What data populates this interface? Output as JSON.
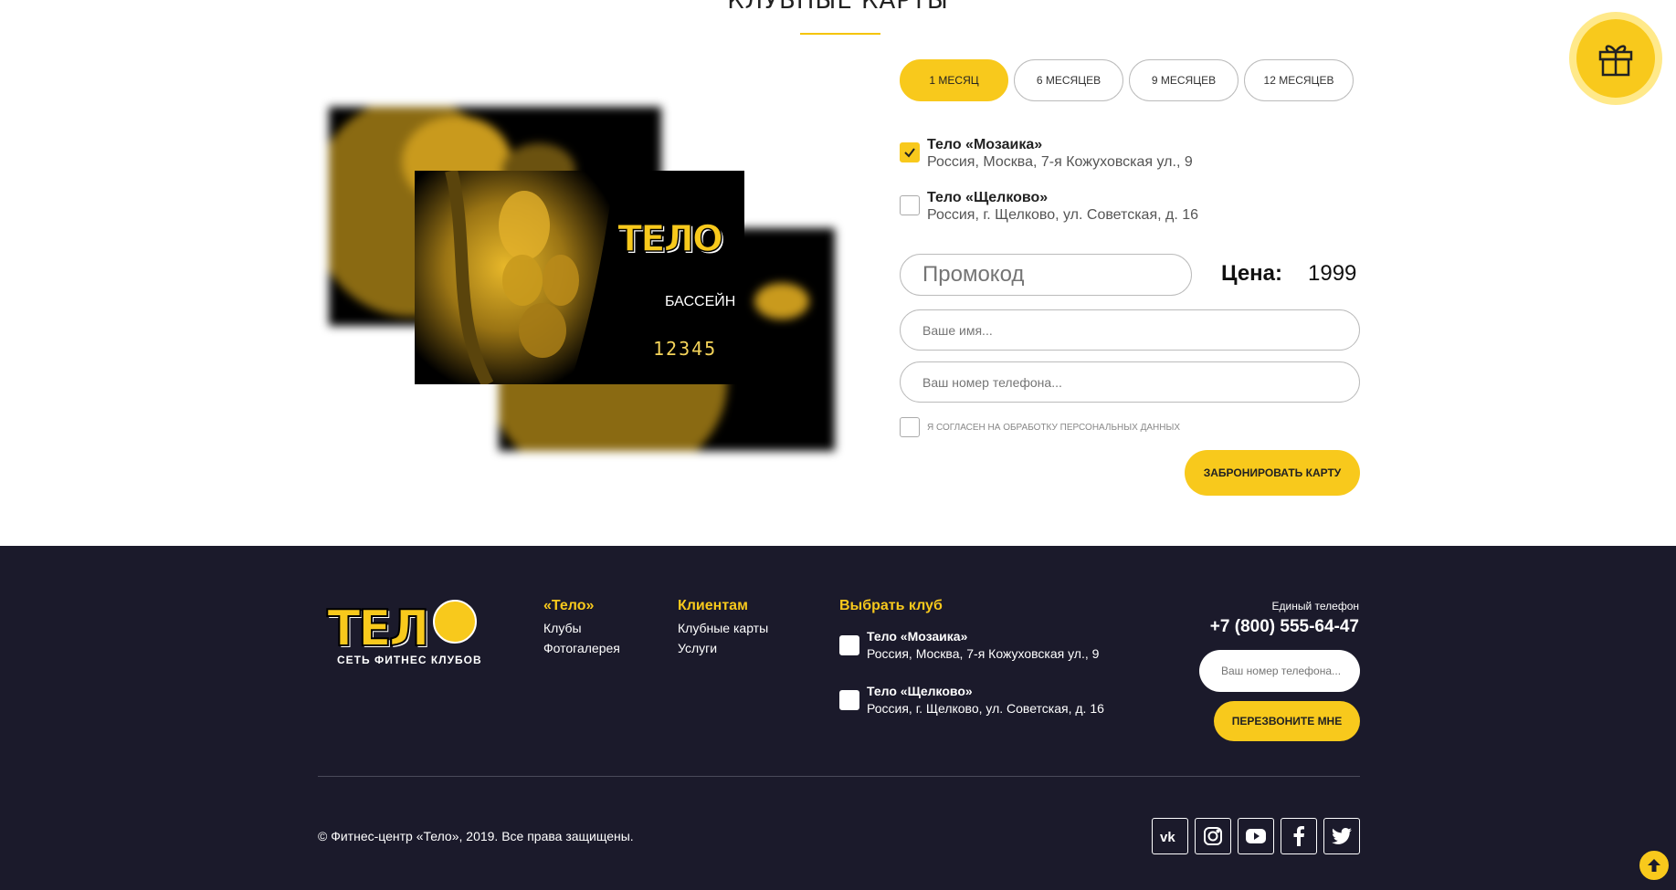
{
  "section": {
    "title": "КЛУБНЫЕ КАРТЫ"
  },
  "card": {
    "logo": "ТЕЛО",
    "label": "БАССЕЙН",
    "number": "12345"
  },
  "tabs": [
    {
      "label": "1 МЕСЯЦ",
      "active": true
    },
    {
      "label": "6 МЕСЯЦЕВ",
      "active": false
    },
    {
      "label": "9 МЕСЯЦЕВ",
      "active": false
    },
    {
      "label": "12 МЕСЯЦЕВ",
      "active": false
    }
  ],
  "clubs": [
    {
      "name": "Тело «Мозаика»",
      "address": "Россия, Москва, 7-я Кожуховская ул., 9",
      "checked": true
    },
    {
      "name": "Тело «Щелково»",
      "address": "Россия, г. Щелково, ул. Советская, д. 16",
      "checked": false
    }
  ],
  "form": {
    "promo_placeholder": "Промокод",
    "price_label": "Цена:",
    "price_value": "1999",
    "name_placeholder": "Ваше имя...",
    "phone_placeholder": "Ваш номер телефона...",
    "agree_label": "Я согласен на обработку персональных данных",
    "book_button": "Забронировать карту"
  },
  "footer": {
    "logo": "ТЕЛ",
    "logo_sub": "СЕТЬ ФИТНЕС КЛУБОВ",
    "col1": {
      "title": "«Тело»",
      "links": [
        "Клубы",
        "Фотогалерея"
      ]
    },
    "col2": {
      "title": "Клиентам",
      "links": [
        "Клубные карты",
        "Услуги"
      ]
    },
    "col3": {
      "title": "Выбрать клуб"
    },
    "clubs": [
      {
        "name": "Тело «Мозаика»",
        "address": "Россия, Москва, 7-я Кожуховская ул., 9"
      },
      {
        "name": "Тело «Щелково»",
        "address": "Россия, г. Щелково, ул. Советская, д. 16"
      }
    ],
    "phone_label": "Единый телефон",
    "phone": "+7 (800) 555-64-47",
    "phone_placeholder": "Ваш номер телефона...",
    "callback_button": "Перезвоните мне",
    "copyright": "© Фитнес-центр «Тело», 2019. Все права защищены.",
    "socials": [
      "vk-icon",
      "instagram-icon",
      "youtube-icon",
      "facebook-icon",
      "twitter-icon"
    ]
  },
  "colors": {
    "accent": "#f8c91c",
    "footer_bg": "#1b1a2b"
  }
}
